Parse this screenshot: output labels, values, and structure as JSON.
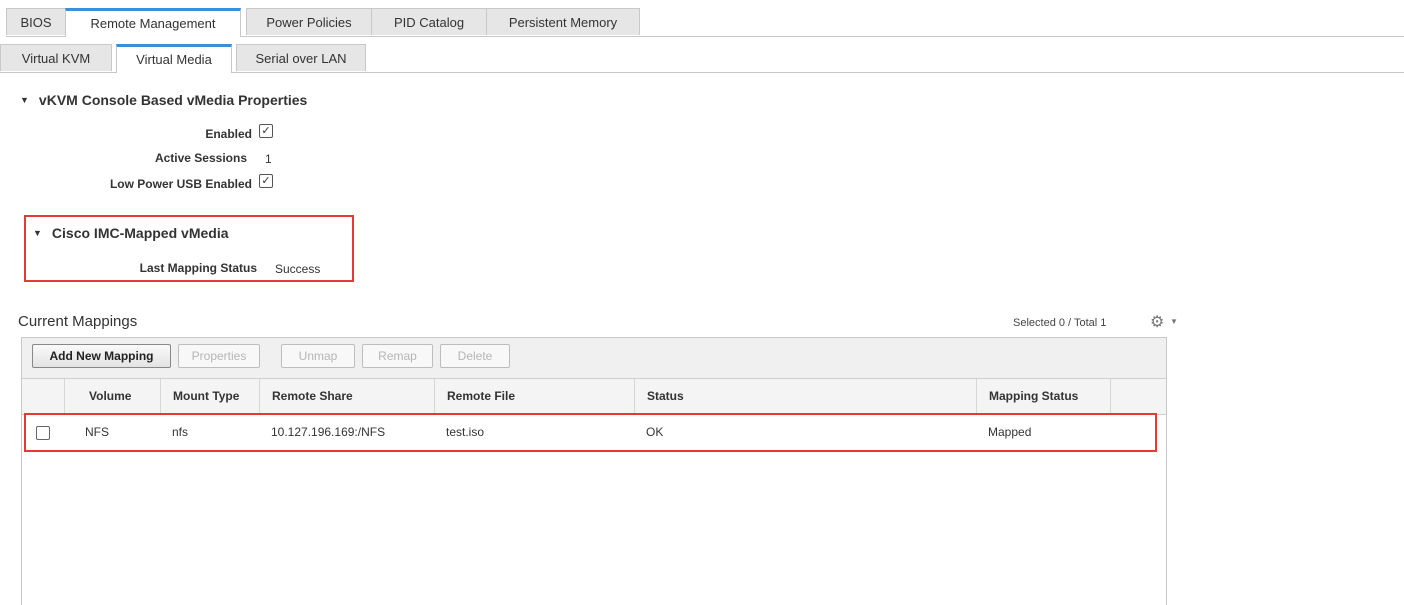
{
  "tabs_top": [
    "BIOS",
    "Remote Management",
    "Power Policies",
    "PID Catalog",
    "Persistent Memory"
  ],
  "tabs_sub": [
    "Virtual KVM",
    "Virtual Media",
    "Serial over LAN"
  ],
  "vkvm_section": {
    "title": "vKVM Console Based vMedia Properties",
    "enabled_label": "Enabled",
    "enabled": true,
    "active_sessions_label": "Active Sessions",
    "active_sessions_value": "1",
    "low_power_label": "Low Power USB Enabled",
    "low_power_enabled": true
  },
  "imc_section": {
    "title": "Cisco IMC-Mapped vMedia",
    "last_mapping_label": "Last Mapping Status",
    "last_mapping_value": "Success"
  },
  "mappings": {
    "title": "Current Mappings",
    "selected_text": "Selected 0 / Total 1",
    "buttons": {
      "add": "Add New Mapping",
      "properties": "Properties",
      "unmap": "Unmap",
      "remap": "Remap",
      "delete": "Delete"
    },
    "columns": [
      "Volume",
      "Mount Type",
      "Remote Share",
      "Remote File",
      "Status",
      "Mapping Status"
    ],
    "rows": [
      [
        "NFS",
        "nfs",
        "10.127.196.169:/NFS",
        "test.iso",
        "OK",
        "Mapped"
      ]
    ]
  },
  "icons": {
    "gear": "gear-icon",
    "caret": "chevron-down-icon",
    "check": "checkmark-icon",
    "expand": "triangle-down-icon"
  },
  "colors": {
    "highlight_box": "#e53935",
    "active_tab_accent": "#3a8fd6"
  }
}
